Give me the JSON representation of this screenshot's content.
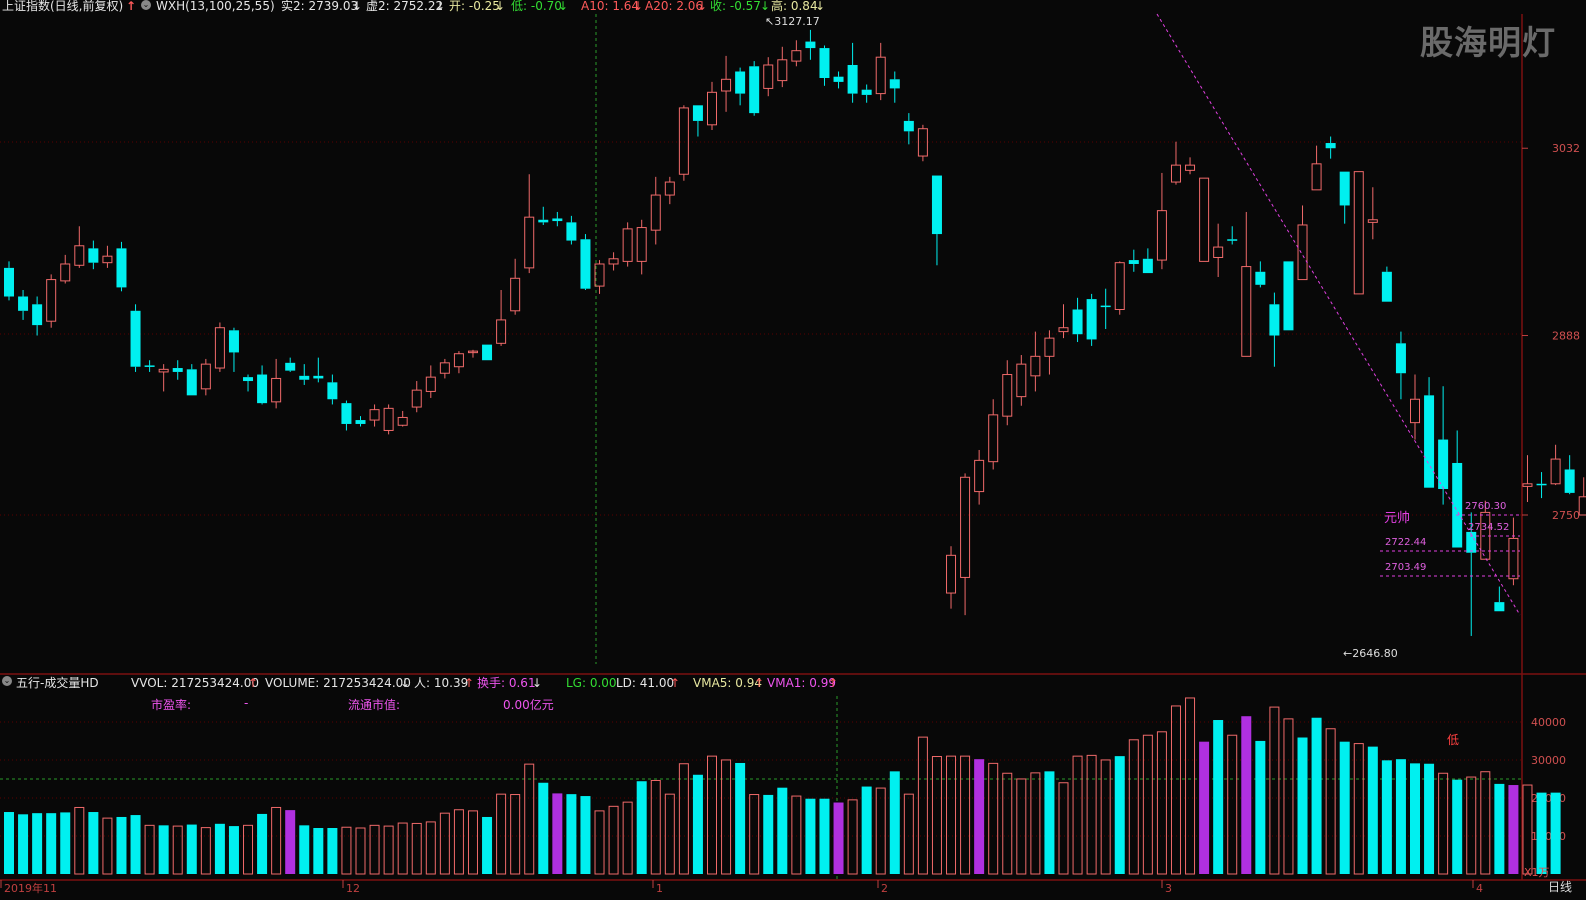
{
  "header": {
    "index_title": "上证指数(日线,前复权)",
    "indicator": "WXH(13,100,25,55)",
    "shi2": "实2: 2739.03",
    "xu2": "虚2: 2752.22",
    "kai": "开: -0.25",
    "di": "低: -0.70",
    "a10": "A10: 1.64",
    "a20": "A20: 2.06",
    "shou": "收: -0.57",
    "gao": "高: 0.84"
  },
  "watermark": "股海明灯",
  "volume_header": {
    "panel_title": "五行-成交量HD",
    "vvol": "VVOL: 217253424.00",
    "volume": "VOLUME: 217253424.00",
    "ren": "人: 10.39",
    "huanshou": "换手: 0.61",
    "lg": "LG: 0.00",
    "ld": "LD: 41.00",
    "vma5": "VMA5: 0.94",
    "vma1": "VMA1: 0.99",
    "pe_label": "市盈率:",
    "pe_value": "-",
    "float_label": "流通市值:",
    "float_value": "0.00亿元"
  },
  "volume_unit": "X1万",
  "period_label": "日线",
  "low_marker": "低",
  "chart_data": [
    {
      "type": "candlestick",
      "title": "上证指数(日线,前复权)",
      "ylim": [
        2620,
        3140
      ],
      "y_ticks": [
        2750,
        2888,
        3032
      ],
      "x_ticks": [
        "2019年11",
        "12",
        "1",
        "2",
        "3",
        "4"
      ],
      "annotations": {
        "high": "3127.17",
        "low": "2646.80",
        "levels": [
          "2760.30",
          "2734.52",
          "2722.44",
          "2703.49"
        ],
        "name_label": "元帅"
      },
      "colors": {
        "up": "#f06a6a",
        "down": "#00f0f0",
        "trendline": "#e040e0"
      },
      "candles": [
        [
          "d",
          2940,
          2918,
          2945,
          2915
        ],
        [
          "d",
          2918,
          2907,
          2923,
          2900
        ],
        [
          "d",
          2912,
          2896,
          2918,
          2888
        ],
        [
          "u",
          2899,
          2931,
          2935,
          2894
        ],
        [
          "u",
          2930,
          2943,
          2950,
          2928
        ],
        [
          "u",
          2942,
          2957,
          2972,
          2940
        ],
        [
          "d",
          2955,
          2944,
          2961,
          2939
        ],
        [
          "u",
          2944,
          2949,
          2957,
          2940
        ],
        [
          "d",
          2955,
          2925,
          2960,
          2922
        ],
        [
          "d",
          2907,
          2864,
          2912,
          2860
        ],
        [
          "d",
          2865,
          2864,
          2869,
          2860
        ],
        [
          "u",
          2860,
          2862,
          2866,
          2845
        ],
        [
          "d",
          2863,
          2860,
          2869,
          2854
        ],
        [
          "d",
          2862,
          2842,
          2866,
          2842
        ],
        [
          "u",
          2847,
          2866,
          2870,
          2842
        ],
        [
          "u",
          2863,
          2894,
          2898,
          2860
        ],
        [
          "d",
          2892,
          2875,
          2894,
          2860
        ],
        [
          "d",
          2856,
          2853,
          2858,
          2845
        ],
        [
          "d",
          2858,
          2836,
          2865,
          2835
        ],
        [
          "u",
          2837,
          2855,
          2870,
          2832
        ],
        [
          "d",
          2861,
          2867,
          2871,
          2860
        ],
        [
          "d",
          2857,
          2854,
          2866,
          2850
        ],
        [
          "d",
          2857,
          2855,
          2871,
          2852
        ],
        [
          "d",
          2852,
          2839,
          2858,
          2835
        ],
        [
          "d",
          2836,
          2820,
          2838,
          2815
        ],
        [
          "d",
          2823,
          2820,
          2826,
          2818
        ],
        [
          "u",
          2823,
          2831,
          2835,
          2818
        ],
        [
          "u",
          2815,
          2832,
          2835,
          2812
        ],
        [
          "u",
          2819,
          2825,
          2830,
          2818
        ],
        [
          "u",
          2833,
          2846,
          2853,
          2829
        ],
        [
          "u",
          2845,
          2856,
          2865,
          2840
        ],
        [
          "u",
          2859,
          2867,
          2870,
          2855
        ],
        [
          "u",
          2864,
          2874,
          2876,
          2859
        ],
        [
          "u",
          2876,
          2876,
          2877,
          2871
        ],
        [
          "d",
          2881,
          2869,
          2881,
          2869
        ],
        [
          "u",
          2882,
          2900,
          2923,
          2880
        ],
        [
          "u",
          2907,
          2932,
          2947,
          2904
        ],
        [
          "u",
          2940,
          2979,
          3012,
          2936
        ],
        [
          "d",
          2977,
          2975,
          2987,
          2973
        ],
        [
          "d",
          2978,
          2976,
          2983,
          2972
        ],
        [
          "d",
          2975,
          2961,
          2980,
          2958
        ],
        [
          "d",
          2962,
          2924,
          2966,
          2923
        ],
        [
          "u",
          2926,
          2943,
          2946,
          2920
        ],
        [
          "u",
          2943,
          2947,
          2952,
          2938
        ],
        [
          "u",
          2945,
          2970,
          2975,
          2941
        ],
        [
          "u",
          2945,
          2971,
          2977,
          2935
        ],
        [
          "u",
          2969,
          2996,
          3010,
          2958
        ],
        [
          "u",
          2996,
          3006,
          3010,
          2989
        ],
        [
          "u",
          3012,
          3063,
          3065,
          3007
        ],
        [
          "d",
          3065,
          3053,
          3065,
          3041
        ],
        [
          "u",
          3050,
          3075,
          3083,
          3046
        ],
        [
          "u",
          3076,
          3085,
          3103,
          3060
        ],
        [
          "d",
          3091,
          3074,
          3094,
          3065
        ],
        [
          "d",
          3095,
          3059,
          3099,
          3057
        ],
        [
          "u",
          3078,
          3096,
          3102,
          3072
        ],
        [
          "u",
          3084,
          3100,
          3110,
          3079
        ],
        [
          "u",
          3099,
          3107,
          3115,
          3095
        ],
        [
          "d",
          3109,
          3114,
          3123,
          3100
        ],
        [
          "d",
          3109,
          3086,
          3111,
          3080
        ],
        [
          "d",
          3087,
          3083,
          3091,
          3078
        ],
        [
          "d",
          3096,
          3074,
          3113,
          3067
        ],
        [
          "d",
          3077,
          3073,
          3081,
          3067
        ],
        [
          "u",
          3074,
          3102,
          3113,
          3069
        ],
        [
          "d",
          3085,
          3078,
          3091,
          3067
        ],
        [
          "d",
          3053,
          3045,
          3059,
          3035
        ],
        [
          "u",
          3026,
          3047,
          3050,
          3022
        ],
        [
          "d",
          3011,
          2966,
          3011,
          2942
        ],
        [
          "u",
          2690,
          2719,
          2726,
          2678
        ],
        [
          "u",
          2702,
          2779,
          2782,
          2673
        ],
        [
          "u",
          2768,
          2792,
          2800,
          2758
        ],
        [
          "u",
          2791,
          2827,
          2839,
          2785
        ],
        [
          "u",
          2826,
          2858,
          2869,
          2819
        ],
        [
          "u",
          2841,
          2866,
          2873,
          2834
        ],
        [
          "u",
          2857,
          2872,
          2891,
          2845
        ],
        [
          "u",
          2872,
          2886,
          2892,
          2858
        ],
        [
          "u",
          2891,
          2894,
          2912,
          2886
        ],
        [
          "d",
          2889,
          2908,
          2917,
          2883
        ],
        [
          "d",
          2885,
          2916,
          2920,
          2880
        ],
        [
          "d",
          2911,
          2911,
          2924,
          2893
        ],
        [
          "u",
          2908,
          2944,
          2945,
          2904
        ],
        [
          "d",
          2946,
          2943,
          2954,
          2937
        ],
        [
          "d",
          2947,
          2936,
          2955,
          2938
        ],
        [
          "u",
          2946,
          2984,
          3013,
          2939
        ],
        [
          "u",
          3006,
          3019,
          3037,
          3004
        ],
        [
          "u",
          3019,
          3015,
          3025,
          3012
        ],
        [
          "u",
          3009,
          2945,
          2996,
          2964
        ],
        [
          "u",
          2948,
          2956,
          2974,
          2933
        ],
        [
          "d",
          2961,
          2962,
          2972,
          2958
        ],
        [
          "u",
          2872,
          2941,
          2983,
          2963
        ],
        [
          "d",
          2927,
          2937,
          2945,
          2925
        ],
        [
          "d",
          2912,
          2888,
          2921,
          2864
        ],
        [
          "d",
          2892,
          2945,
          2944,
          2898
        ],
        [
          "u",
          2931,
          2973,
          2988,
          2950
        ],
        [
          "u",
          3000,
          3020,
          3034,
          3016
        ],
        [
          "d",
          3032,
          3036,
          3041,
          3024
        ],
        [
          "d",
          3014,
          2988,
          3010,
          2974
        ],
        [
          "u",
          2920,
          3014,
          3011,
          2936
        ],
        [
          "u",
          2977,
          2975,
          3002,
          2962
        ],
        [
          "d",
          2937,
          2914,
          2941,
          2933
        ],
        [
          "d",
          2882,
          2859,
          2891,
          2839
        ],
        [
          "u",
          2821,
          2839,
          2858,
          2808
        ],
        [
          "d",
          2842,
          2771,
          2856,
          2773
        ],
        [
          "d",
          2808,
          2770,
          2849,
          2758
        ],
        [
          "d",
          2790,
          2725,
          2815,
          2725
        ],
        [
          "d",
          2721,
          2737,
          2752,
          2657
        ],
        [
          "u",
          2716,
          2752,
          2761,
          2717
        ],
        [
          "d",
          2676,
          2683,
          2695,
          2676
        ],
        [
          "u",
          2701,
          2732,
          2748,
          2696
        ],
        [
          "u",
          2772,
          2774,
          2796,
          2760
        ],
        [
          "d",
          2773,
          2774,
          2783,
          2763
        ],
        [
          "u",
          2774,
          2793,
          2804,
          2773
        ],
        [
          "d",
          2785,
          2767,
          2796,
          2766
        ],
        [
          "u",
          2750,
          2764,
          2779,
          2759
        ],
        [
          "d",
          2768,
          2762,
          2773,
          2737
        ],
        [
          "d",
          2739,
          2759,
          2774,
          2742
        ]
      ],
      "volumes": [
        [
          16300,
          "c"
        ],
        [
          15700,
          "c"
        ],
        [
          16000,
          "c"
        ],
        [
          16000,
          "c"
        ],
        [
          16200,
          "c"
        ],
        [
          17500,
          "r"
        ],
        [
          16300,
          "c"
        ],
        [
          14700,
          "r"
        ],
        [
          15000,
          "c"
        ],
        [
          15500,
          "c"
        ],
        [
          12800,
          "r"
        ],
        [
          12800,
          "c"
        ],
        [
          12600,
          "r"
        ],
        [
          13000,
          "c"
        ],
        [
          12200,
          "r"
        ],
        [
          13200,
          "c"
        ],
        [
          12600,
          "c"
        ],
        [
          12800,
          "r"
        ],
        [
          15800,
          "c"
        ],
        [
          17500,
          "r"
        ],
        [
          16800,
          "m"
        ],
        [
          12800,
          "c"
        ],
        [
          12100,
          "c"
        ],
        [
          12100,
          "c"
        ],
        [
          12300,
          "r"
        ],
        [
          12100,
          "r"
        ],
        [
          12800,
          "r"
        ],
        [
          12600,
          "r"
        ],
        [
          13400,
          "r"
        ],
        [
          13300,
          "r"
        ],
        [
          13700,
          "r"
        ],
        [
          16000,
          "r"
        ],
        [
          16900,
          "r"
        ],
        [
          16600,
          "r"
        ],
        [
          15000,
          "c"
        ],
        [
          21000,
          "r"
        ],
        [
          20900,
          "r"
        ],
        [
          28900,
          "r"
        ],
        [
          24000,
          "c"
        ],
        [
          21200,
          "m"
        ],
        [
          21000,
          "c"
        ],
        [
          20500,
          "c"
        ],
        [
          16600,
          "r"
        ],
        [
          17800,
          "r"
        ],
        [
          18900,
          "r"
        ],
        [
          24400,
          "c"
        ],
        [
          24600,
          "r"
        ],
        [
          21000,
          "r"
        ],
        [
          29000,
          "r"
        ],
        [
          26100,
          "c"
        ],
        [
          31000,
          "r"
        ],
        [
          30000,
          "r"
        ],
        [
          29200,
          "c"
        ],
        [
          20900,
          "r"
        ],
        [
          20800,
          "c"
        ],
        [
          22700,
          "c"
        ],
        [
          20500,
          "r"
        ],
        [
          19800,
          "c"
        ],
        [
          19800,
          "c"
        ],
        [
          18800,
          "m"
        ],
        [
          19500,
          "r"
        ],
        [
          23000,
          "c"
        ],
        [
          22600,
          "r"
        ],
        [
          27000,
          "c"
        ],
        [
          21000,
          "r"
        ],
        [
          36000,
          "r"
        ],
        [
          30900,
          "r"
        ],
        [
          31000,
          "r"
        ],
        [
          31000,
          "r"
        ],
        [
          30200,
          "m"
        ],
        [
          29100,
          "r"
        ],
        [
          26500,
          "r"
        ],
        [
          25000,
          "r"
        ],
        [
          26600,
          "r"
        ],
        [
          27000,
          "c"
        ],
        [
          24000,
          "r"
        ],
        [
          31000,
          "r"
        ],
        [
          31200,
          "r"
        ],
        [
          30000,
          "r"
        ],
        [
          31000,
          "c"
        ],
        [
          35300,
          "r"
        ],
        [
          36500,
          "r"
        ],
        [
          37400,
          "r"
        ],
        [
          44200,
          "r"
        ],
        [
          46300,
          "r"
        ],
        [
          34800,
          "m"
        ],
        [
          40500,
          "c"
        ],
        [
          36500,
          "r"
        ],
        [
          41500,
          "m"
        ],
        [
          35000,
          "c"
        ],
        [
          43900,
          "r"
        ],
        [
          40800,
          "r"
        ],
        [
          35900,
          "c"
        ],
        [
          41100,
          "c"
        ],
        [
          38200,
          "r"
        ],
        [
          34800,
          "c"
        ],
        [
          34300,
          "r"
        ],
        [
          33500,
          "c"
        ],
        [
          29900,
          "c"
        ],
        [
          30200,
          "c"
        ],
        [
          29100,
          "c"
        ],
        [
          29000,
          "c"
        ],
        [
          26500,
          "r"
        ],
        [
          24800,
          "c"
        ],
        [
          25500,
          "r"
        ],
        [
          26900,
          "r"
        ],
        [
          23700,
          "c"
        ],
        [
          23400,
          "m"
        ],
        [
          23400,
          "r"
        ],
        [
          21400,
          "c"
        ],
        [
          21400,
          "c"
        ]
      ]
    }
  ]
}
